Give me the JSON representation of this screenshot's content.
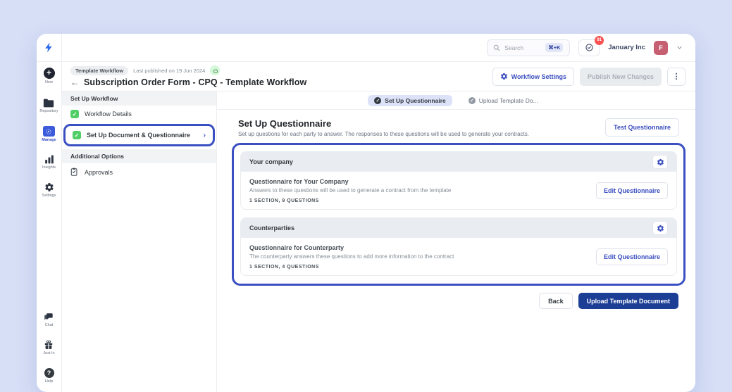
{
  "topbar": {
    "search": {
      "placeholder": "Search",
      "shortcut": "⌘+K"
    },
    "notification_count": "91",
    "org_name": "January Inc",
    "avatar_letter": "F"
  },
  "rail": {
    "items": [
      {
        "label": "New"
      },
      {
        "label": "Repository"
      },
      {
        "label": "Manage"
      },
      {
        "label": "Insights"
      },
      {
        "label": "Settings"
      }
    ],
    "bottom_items": [
      {
        "label": "Chat"
      },
      {
        "label": "Just In"
      },
      {
        "label": "Help"
      }
    ],
    "help_glyph": "?",
    "new_glyph": "+"
  },
  "header": {
    "badge": "Template Workflow",
    "published": "Last published on 19 Jun 2024",
    "back_arrow": "←",
    "title": "Subscription Order Form - CPQ - Template Workflow",
    "workflow_settings_label": "Workflow Settings",
    "publish_label": "Publish New Changes",
    "kebab": "⋮"
  },
  "steps_panel": {
    "section1_title": "Set Up Workflow",
    "item1_label": "Workflow Details",
    "item2_label": "Set Up Document & Questionnaire",
    "check_glyph": "✓",
    "chevron": "›",
    "section2_title": "Additional Options",
    "approvals_label": "Approvals"
  },
  "stepper": {
    "active_label": "Set Up Questionnaire",
    "inactive_label": "Upload Template Do...",
    "check_glyph": "✓"
  },
  "main": {
    "title": "Set Up Questionnaire",
    "subtitle": "Set up questions for each party to answer. The responses to these questions will be used to generate your contracts.",
    "test_button": "Test Questionnaire",
    "cards": [
      {
        "header": "Your company",
        "title": "Questionnaire for Your Company",
        "desc": "Answers to these questions will be used to generate a contract from the template",
        "meta": "1 SECTION, 9 QUESTIONS",
        "action": "Edit Questionnaire"
      },
      {
        "header": "Counterparties",
        "title": "Questionnaire for Counterparty",
        "desc": "The counterparty answers these questions to add more information to the contract",
        "meta": "1 SECTION, 4 QUESTIONS",
        "action": "Edit Questionnaire"
      }
    ],
    "back_button": "Back",
    "upload_button": "Upload Template Document"
  },
  "colors": {
    "accent_blue": "#3a4fc1",
    "navy_button": "#1c3e95",
    "green_check": "#51cf66",
    "badge_red": "#fa5252",
    "avatar_pink": "#c75f72",
    "page_bg": "#d7dff6"
  }
}
